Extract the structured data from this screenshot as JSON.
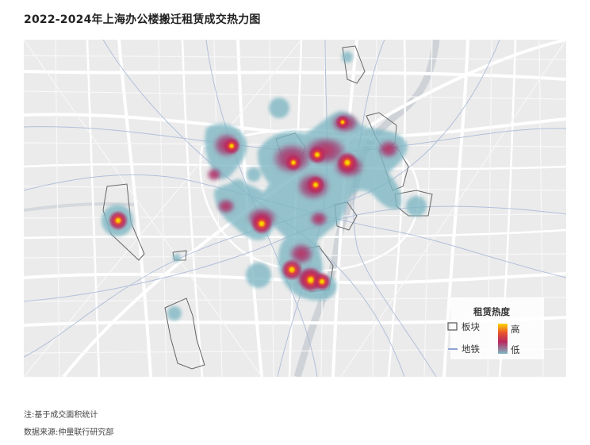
{
  "title": "2022-2024年上海办公楼搬迁租赁成交热力图",
  "legend": {
    "district_label": "板块",
    "metro_label": "地铁",
    "heat_title": "租赁热度",
    "heat_high": "高",
    "heat_low": "低"
  },
  "colors": {
    "map_background": "#ebebeb",
    "road": "#ffffff",
    "metro": "#a9b8d8",
    "river": "#c9cdd2",
    "heat_low": "#7fb7c4",
    "heat_mid": "#b8285e",
    "heat_high": "#f3c200"
  },
  "notes": {
    "note": "注:基于成交面积统计",
    "source": "数据来源:仲量联行研究部"
  }
}
